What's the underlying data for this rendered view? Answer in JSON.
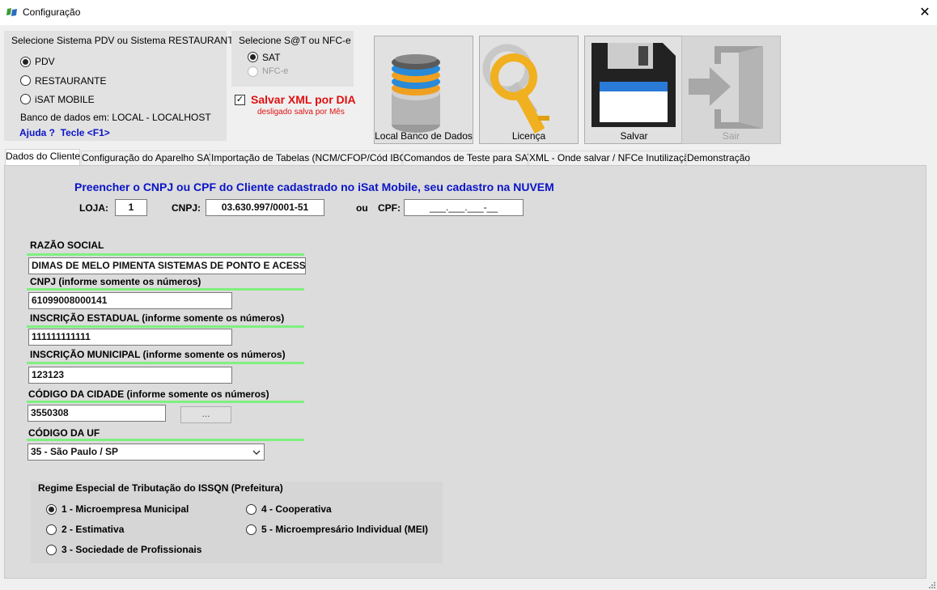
{
  "window": {
    "title": "Configuração",
    "close_glyph": "✕"
  },
  "system_group": {
    "label": "Selecione Sistema PDV ou Sistema RESTAURANTE",
    "options": [
      "PDV",
      "RESTAURANTE",
      "iSAT MOBILE"
    ],
    "selected": "PDV",
    "db_info": "Banco de dados em: LOCAL - LOCALHOST",
    "help": "Ajuda ?  Tecle <F1>"
  },
  "sat_group": {
    "label": "Selecione S@T ou NFC-e",
    "options": [
      "SAT",
      "NFC-e"
    ],
    "selected": "SAT"
  },
  "xml_checkbox": {
    "label": "Salvar XML por DIA",
    "note": "desligado salva por Mês",
    "checked": true
  },
  "toolbar": {
    "db_button": "Local Banco de Dados",
    "license_button": "Licença",
    "save_button": "Salvar",
    "exit_button": "Sair"
  },
  "tabs": [
    "Dados do Cliente",
    "Configuração do Aparelho SAT",
    "Importação de Tabelas (NCM/CFOP/Cód IBGE)",
    "Comandos de Teste para SAT",
    "XML - Onde salvar / NFCe Inutilização",
    "Demonstração"
  ],
  "active_tab": "Dados do Cliente",
  "client": {
    "heading": "Preencher o CNPJ ou CPF do Cliente cadastrado no iSat Mobile, seu cadastro na NUVEM",
    "loja_label": "LOJA:",
    "loja_value": "1",
    "cnpj_label": "CNPJ:",
    "cnpj_value": "03.630.997/0001-51",
    "ou_label": "ou",
    "cpf_label": "CPF:",
    "cpf_mask": "___.___.___-__"
  },
  "form": {
    "razao_label": "RAZÃO SOCIAL",
    "razao_value": "DIMAS DE MELO PIMENTA SISTEMAS DE PONTO E ACESSO",
    "cnpj_label": "CNPJ (informe somente os números)",
    "cnpj_value": "61099008000141",
    "ie_label": "INSCRIÇÃO ESTADUAL (informe somente os números)",
    "ie_value": "111111111111",
    "im_label": "INSCRIÇÃO MUNICIPAL (informe somente os números)",
    "im_value": "123123",
    "cidade_label": "CÓDIGO DA CIDADE (informe somente os números)",
    "cidade_value": "3550308",
    "cidade_button": "...",
    "uf_label": "CÓDIGO DA UF",
    "uf_value": "35 - São Paulo / SP"
  },
  "regime": {
    "label": "Regime Especial de Tributação do ISSQN (Prefeitura)",
    "options": [
      "1 - Microempresa Municipal",
      "2 - Estimativa",
      "3 - Sociedade de Profissionais",
      "4 - Cooperativa",
      "5 - Microempresário Individual (MEI)"
    ],
    "selected": "1 - Microempresa Municipal"
  },
  "colors": {
    "heading": "#0a14c8",
    "xml_label": "#e01010",
    "underline": "#7ff07f",
    "help_link": "#0a14c8"
  }
}
